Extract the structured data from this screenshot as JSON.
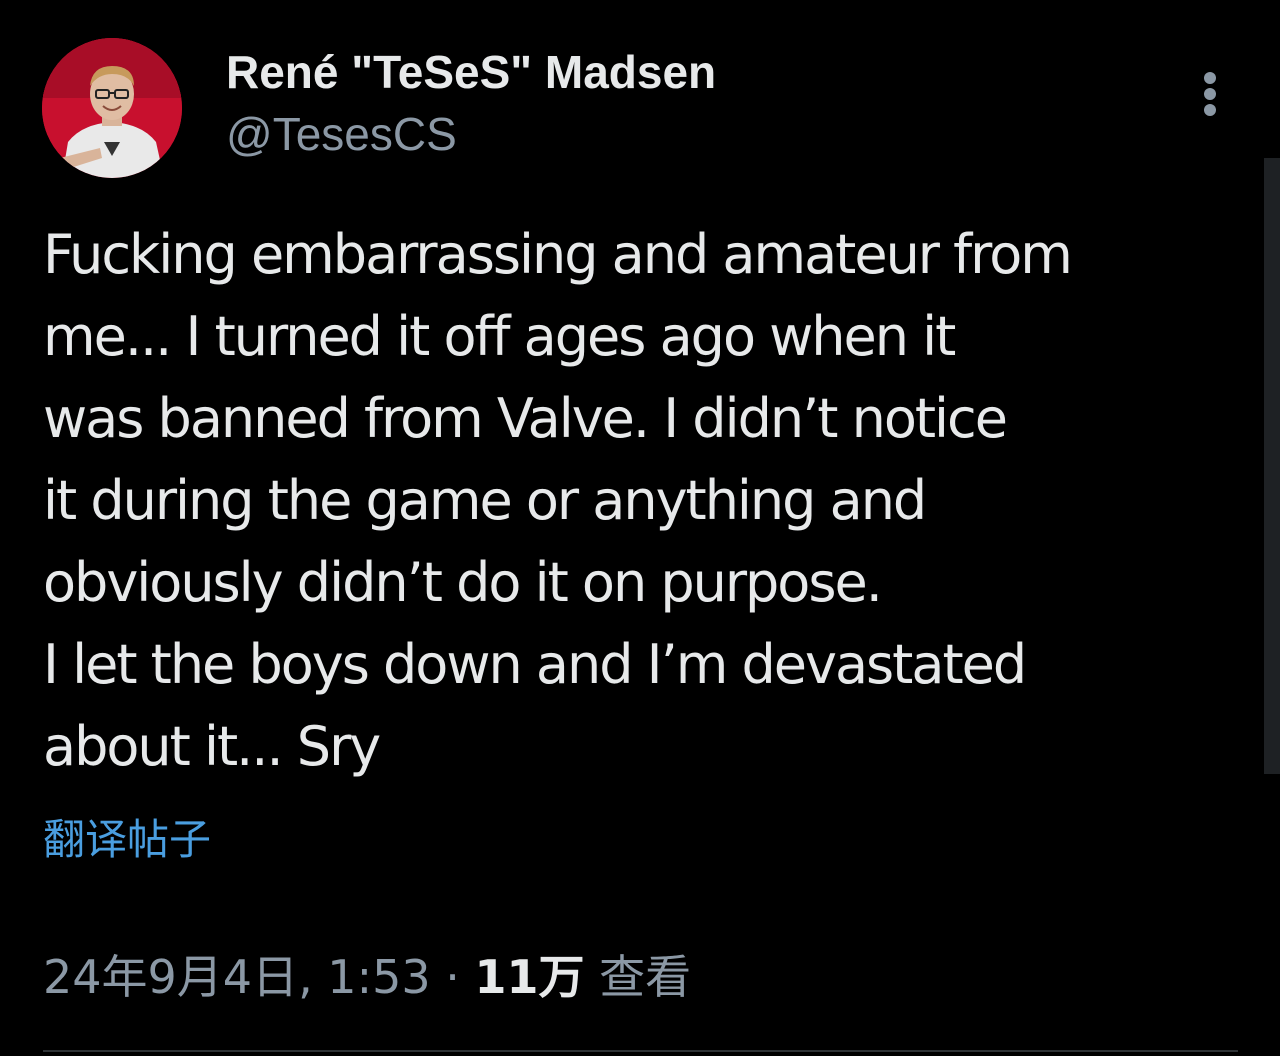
{
  "author": {
    "display_name": "René \"TeSeS\" Madsen",
    "handle": "@TesesCS",
    "avatar_icon": "profile-photo-icon"
  },
  "tweet": {
    "lines": [
      "Fucking embarrassing and amateur from",
      "me... I turned it off ages ago when it",
      "was banned from Valve. I didn’t notice",
      "it during the game or anything and",
      "obviously didn’t do it on purpose.",
      "I let the boys down and I’m devastated",
      "about it... Sry"
    ]
  },
  "translate": {
    "label": "翻译帖子"
  },
  "meta": {
    "timestamp": "24年9月4日, 1:53",
    "separator": " · ",
    "views_count": "11万",
    "views_label": " 查看"
  },
  "colors": {
    "background": "#000000",
    "text_primary": "#e7e9ea",
    "text_secondary": "#8b98a5",
    "link": "#4a9ee0",
    "avatar_bg": "#c8102e"
  },
  "icons": {
    "more": "more-vertical-icon"
  }
}
